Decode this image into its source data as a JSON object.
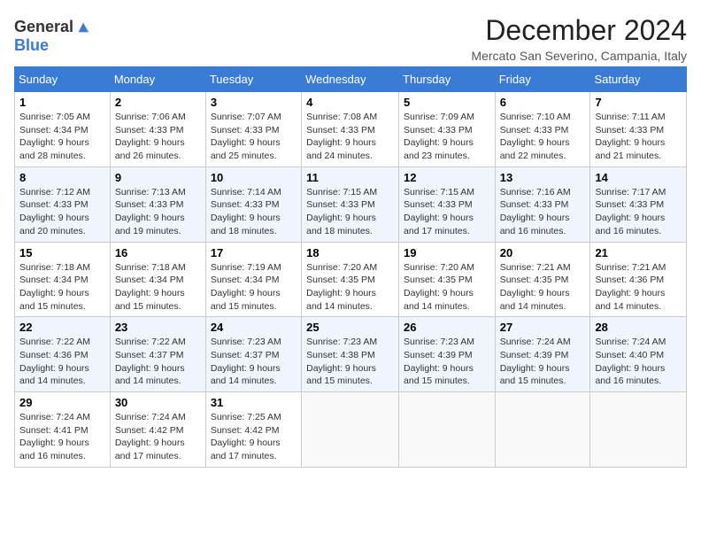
{
  "logo": {
    "general": "General",
    "blue": "Blue"
  },
  "title": "December 2024",
  "location": "Mercato San Severino, Campania, Italy",
  "days_header": [
    "Sunday",
    "Monday",
    "Tuesday",
    "Wednesday",
    "Thursday",
    "Friday",
    "Saturday"
  ],
  "weeks": [
    [
      {
        "day": "1",
        "sunrise": "7:05 AM",
        "sunset": "4:34 PM",
        "daylight": "9 hours and 28 minutes."
      },
      {
        "day": "2",
        "sunrise": "7:06 AM",
        "sunset": "4:33 PM",
        "daylight": "9 hours and 26 minutes."
      },
      {
        "day": "3",
        "sunrise": "7:07 AM",
        "sunset": "4:33 PM",
        "daylight": "9 hours and 25 minutes."
      },
      {
        "day": "4",
        "sunrise": "7:08 AM",
        "sunset": "4:33 PM",
        "daylight": "9 hours and 24 minutes."
      },
      {
        "day": "5",
        "sunrise": "7:09 AM",
        "sunset": "4:33 PM",
        "daylight": "9 hours and 23 minutes."
      },
      {
        "day": "6",
        "sunrise": "7:10 AM",
        "sunset": "4:33 PM",
        "daylight": "9 hours and 22 minutes."
      },
      {
        "day": "7",
        "sunrise": "7:11 AM",
        "sunset": "4:33 PM",
        "daylight": "9 hours and 21 minutes."
      }
    ],
    [
      {
        "day": "8",
        "sunrise": "7:12 AM",
        "sunset": "4:33 PM",
        "daylight": "9 hours and 20 minutes."
      },
      {
        "day": "9",
        "sunrise": "7:13 AM",
        "sunset": "4:33 PM",
        "daylight": "9 hours and 19 minutes."
      },
      {
        "day": "10",
        "sunrise": "7:14 AM",
        "sunset": "4:33 PM",
        "daylight": "9 hours and 18 minutes."
      },
      {
        "day": "11",
        "sunrise": "7:15 AM",
        "sunset": "4:33 PM",
        "daylight": "9 hours and 18 minutes."
      },
      {
        "day": "12",
        "sunrise": "7:15 AM",
        "sunset": "4:33 PM",
        "daylight": "9 hours and 17 minutes."
      },
      {
        "day": "13",
        "sunrise": "7:16 AM",
        "sunset": "4:33 PM",
        "daylight": "9 hours and 16 minutes."
      },
      {
        "day": "14",
        "sunrise": "7:17 AM",
        "sunset": "4:33 PM",
        "daylight": "9 hours and 16 minutes."
      }
    ],
    [
      {
        "day": "15",
        "sunrise": "7:18 AM",
        "sunset": "4:34 PM",
        "daylight": "9 hours and 15 minutes."
      },
      {
        "day": "16",
        "sunrise": "7:18 AM",
        "sunset": "4:34 PM",
        "daylight": "9 hours and 15 minutes."
      },
      {
        "day": "17",
        "sunrise": "7:19 AM",
        "sunset": "4:34 PM",
        "daylight": "9 hours and 15 minutes."
      },
      {
        "day": "18",
        "sunrise": "7:20 AM",
        "sunset": "4:35 PM",
        "daylight": "9 hours and 14 minutes."
      },
      {
        "day": "19",
        "sunrise": "7:20 AM",
        "sunset": "4:35 PM",
        "daylight": "9 hours and 14 minutes."
      },
      {
        "day": "20",
        "sunrise": "7:21 AM",
        "sunset": "4:35 PM",
        "daylight": "9 hours and 14 minutes."
      },
      {
        "day": "21",
        "sunrise": "7:21 AM",
        "sunset": "4:36 PM",
        "daylight": "9 hours and 14 minutes."
      }
    ],
    [
      {
        "day": "22",
        "sunrise": "7:22 AM",
        "sunset": "4:36 PM",
        "daylight": "9 hours and 14 minutes."
      },
      {
        "day": "23",
        "sunrise": "7:22 AM",
        "sunset": "4:37 PM",
        "daylight": "9 hours and 14 minutes."
      },
      {
        "day": "24",
        "sunrise": "7:23 AM",
        "sunset": "4:37 PM",
        "daylight": "9 hours and 14 minutes."
      },
      {
        "day": "25",
        "sunrise": "7:23 AM",
        "sunset": "4:38 PM",
        "daylight": "9 hours and 15 minutes."
      },
      {
        "day": "26",
        "sunrise": "7:23 AM",
        "sunset": "4:39 PM",
        "daylight": "9 hours and 15 minutes."
      },
      {
        "day": "27",
        "sunrise": "7:24 AM",
        "sunset": "4:39 PM",
        "daylight": "9 hours and 15 minutes."
      },
      {
        "day": "28",
        "sunrise": "7:24 AM",
        "sunset": "4:40 PM",
        "daylight": "9 hours and 16 minutes."
      }
    ],
    [
      {
        "day": "29",
        "sunrise": "7:24 AM",
        "sunset": "4:41 PM",
        "daylight": "9 hours and 16 minutes."
      },
      {
        "day": "30",
        "sunrise": "7:24 AM",
        "sunset": "4:42 PM",
        "daylight": "9 hours and 17 minutes."
      },
      {
        "day": "31",
        "sunrise": "7:25 AM",
        "sunset": "4:42 PM",
        "daylight": "9 hours and 17 minutes."
      },
      null,
      null,
      null,
      null
    ]
  ],
  "labels": {
    "sunrise": "Sunrise: ",
    "sunset": "Sunset: ",
    "daylight": "Daylight: "
  }
}
